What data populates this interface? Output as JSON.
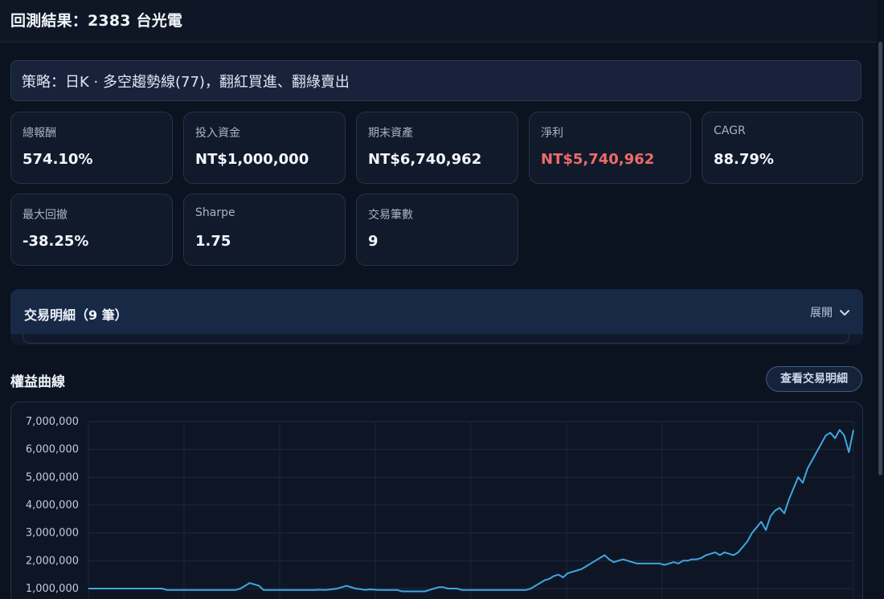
{
  "header": {
    "title": "回測結果：2383 台光電"
  },
  "strategy": {
    "text": "策略：日K · 多空趨勢線(77)，翻紅買進、翻綠賣出"
  },
  "metrics": [
    {
      "label": "總報酬",
      "value": "574.10%"
    },
    {
      "label": "投入資金",
      "value": "NT$1,000,000"
    },
    {
      "label": "期末資產",
      "value": "NT$6,740,962"
    },
    {
      "label": "淨利",
      "value": "NT$5,740,962",
      "color": "#ef6b6b"
    },
    {
      "label": "CAGR",
      "value": "88.79%"
    },
    {
      "label": "最大回撤",
      "value": "-38.25%"
    },
    {
      "label": "Sharpe",
      "value": "1.75"
    },
    {
      "label": "交易筆數",
      "value": "9"
    }
  ],
  "trades": {
    "title": "交易明細（9 筆）",
    "toggle_label": "展開",
    "toggle_icon": "chevron-down"
  },
  "equity": {
    "title": "權益曲線",
    "view_trades_button": "查看交易明細"
  },
  "chart_data": {
    "type": "line",
    "title": "",
    "xlabel": "",
    "ylabel": "",
    "ylim": [
      1000000,
      7000000
    ],
    "yticks": [
      "7,000,000",
      "6,000,000",
      "5,000,000",
      "4,000,000",
      "3,000,000",
      "2,000,000",
      "1,000,000"
    ],
    "grid": true,
    "line_color": "#3fa7e0",
    "series": [
      {
        "values": [
          1000000,
          1000000,
          1000000,
          1000000,
          1000000,
          1000000,
          1000000,
          1000000,
          1000000,
          1000000,
          1000000,
          1000000,
          1000000,
          1000000,
          1000000,
          1000000,
          1000000,
          950000,
          950000,
          950000,
          950000,
          950000,
          950000,
          950000,
          950000,
          950000,
          950000,
          950000,
          950000,
          950000,
          950000,
          950000,
          950000,
          1000000,
          1100000,
          1200000,
          1150000,
          1100000,
          950000,
          950000,
          950000,
          950000,
          950000,
          950000,
          950000,
          950000,
          950000,
          950000,
          950000,
          950000,
          960000,
          950000,
          960000,
          980000,
          1000000,
          1050000,
          1100000,
          1050000,
          1000000,
          980000,
          950000,
          970000,
          960000,
          950000,
          950000,
          950000,
          950000,
          950000,
          900000,
          900000,
          900000,
          900000,
          900000,
          900000,
          950000,
          1000000,
          1050000,
          1050000,
          1000000,
          1000000,
          1000000,
          950000,
          950000,
          950000,
          950000,
          950000,
          950000,
          950000,
          950000,
          950000,
          950000,
          950000,
          950000,
          950000,
          950000,
          950000,
          1000000,
          1100000,
          1200000,
          1300000,
          1350000,
          1450000,
          1500000,
          1400000,
          1550000,
          1600000,
          1650000,
          1700000,
          1800000,
          1900000,
          2000000,
          2100000,
          2200000,
          2050000,
          1950000,
          2000000,
          2050000,
          2000000,
          1950000,
          1900000,
          1900000,
          1900000,
          1900000,
          1900000,
          1900000,
          1850000,
          1900000,
          1950000,
          1900000,
          2000000,
          2000000,
          2050000,
          2050000,
          2100000,
          2200000,
          2250000,
          2300000,
          2200000,
          2300000,
          2250000,
          2200000,
          2300000,
          2500000,
          2700000,
          3000000,
          3200000,
          3400000,
          3100000,
          3600000,
          3800000,
          3900000,
          3700000,
          4200000,
          4600000,
          5000000,
          4800000,
          5300000,
          5600000,
          5900000,
          6200000,
          6500000,
          6600000,
          6400000,
          6700000,
          6500000,
          5900000,
          6700000
        ]
      }
    ]
  }
}
